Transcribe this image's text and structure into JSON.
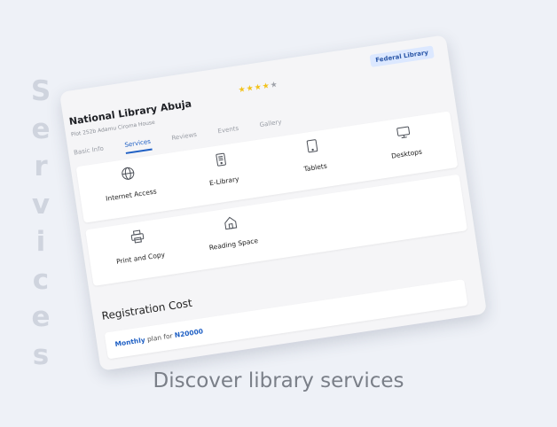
{
  "side_word": [
    "S",
    "e",
    "r",
    "v",
    "i",
    "c",
    "e",
    "s"
  ],
  "caption": "Discover library services",
  "library": {
    "badge": "Federal Library",
    "rating": {
      "value": 4,
      "max": 5
    },
    "name": "National Library Abuja",
    "address": "Plot 252b Adamu Ciroma House",
    "tabs": [
      "Basic Info",
      "Services",
      "Reviews",
      "Events",
      "Gallery"
    ],
    "active_tab": "Services"
  },
  "services": [
    {
      "label": "Internet Access",
      "icon": "globe-icon"
    },
    {
      "label": "E-Library",
      "icon": "ebook-reader-icon"
    },
    {
      "label": "Tablets",
      "icon": "tablet-icon"
    },
    {
      "label": "Desktops",
      "icon": "desktop-monitor-icon"
    },
    {
      "label": "Print and Copy",
      "icon": "printer-icon"
    },
    {
      "label": "Reading Space",
      "icon": "home-icon"
    }
  ],
  "registration": {
    "title": "Registration Cost",
    "plan_name": "Monthly",
    "plan_mid": "plan for",
    "plan_price": "N20000"
  },
  "colors": {
    "accent": "#1e5fc4",
    "star": "#f2c21b",
    "background": "#eef1f7"
  }
}
